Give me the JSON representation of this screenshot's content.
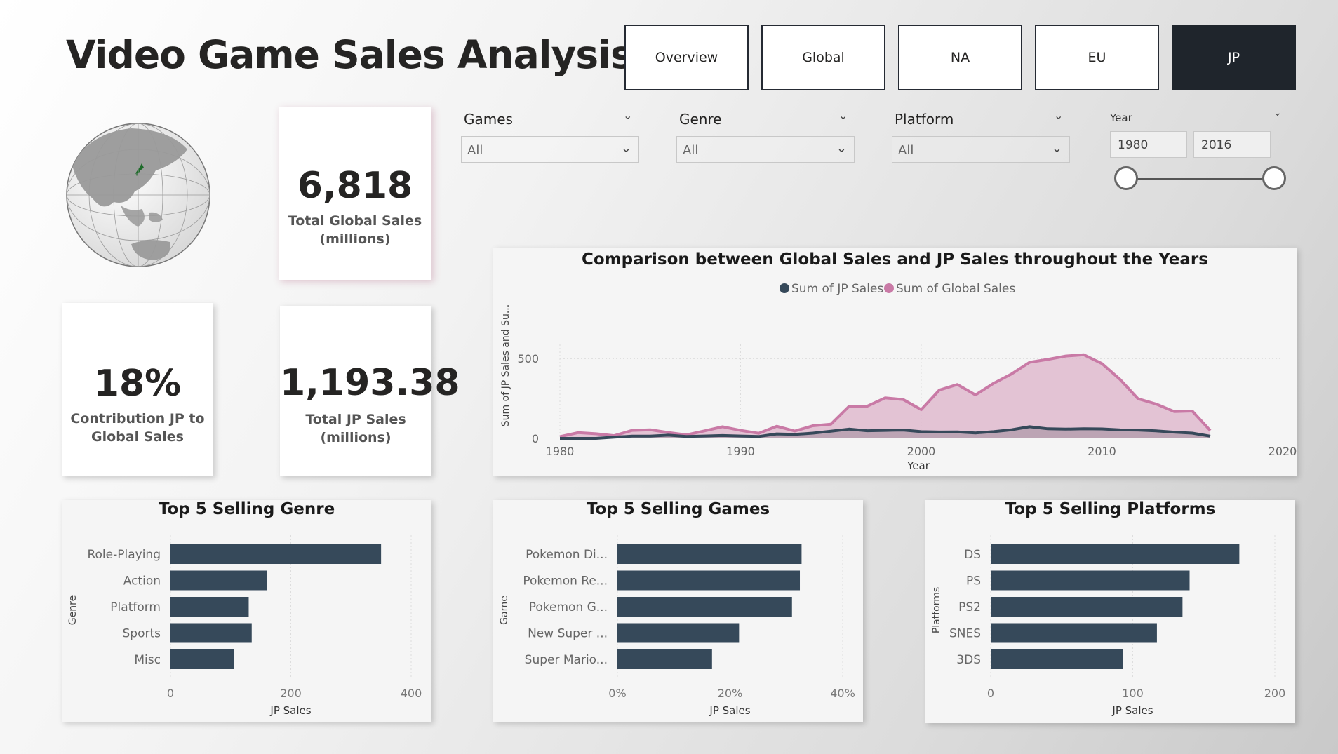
{
  "header": {
    "title": "Video Game Sales Analysis",
    "nav": [
      {
        "label": "Overview",
        "active": false
      },
      {
        "label": "Global",
        "active": false
      },
      {
        "label": "NA",
        "active": false
      },
      {
        "label": "EU",
        "active": false
      },
      {
        "label": "JP",
        "active": true
      }
    ]
  },
  "kpis": {
    "global_sales_value": "6,818",
    "global_sales_label_1": "Total Global Sales",
    "global_sales_label_2": "(millions)",
    "contribution_value": "18%",
    "contribution_label_1": "Contribution JP to",
    "contribution_label_2": "Global Sales",
    "jp_sales_value": "1,193.38",
    "jp_sales_label_1": "Total JP Sales",
    "jp_sales_label_2": "(millions)"
  },
  "slicers": {
    "games": {
      "label": "Games",
      "value": "All"
    },
    "genre": {
      "label": "Genre",
      "value": "All"
    },
    "platform": {
      "label": "Platform",
      "value": "All"
    },
    "year": {
      "label": "Year",
      "from": "1980",
      "to": "2016"
    }
  },
  "colors": {
    "dark_bar": "#36495a",
    "jp_line": "#36495a",
    "global_line": "#c97aa6",
    "global_fill": "#dcb1c8",
    "active_nav": "#1f252c"
  },
  "chart_data": [
    {
      "type": "area",
      "title": "Comparison between Global Sales and JP Sales throughout the Years",
      "xlabel": "Year",
      "ylabel": "Sum of JP Sales and Su...",
      "xlim": [
        1980,
        2020
      ],
      "ylim": [
        0,
        560
      ],
      "xticks": [
        "1980",
        "1990",
        "2000",
        "2010",
        "2020"
      ],
      "yticks": [
        "0",
        "500"
      ],
      "legend": "top-center",
      "x": [
        1980,
        1981,
        1982,
        1983,
        1984,
        1985,
        1986,
        1987,
        1988,
        1989,
        1990,
        1991,
        1992,
        1993,
        1994,
        1995,
        1996,
        1997,
        1998,
        1999,
        2000,
        2001,
        2002,
        2003,
        2004,
        2005,
        2006,
        2007,
        2008,
        2009,
        2010,
        2011,
        2012,
        2013,
        2014,
        2015,
        2016
      ],
      "series": [
        {
          "name": "Sum of JP Sales",
          "values": [
            0,
            0,
            0,
            8,
            14,
            14,
            20,
            12,
            15,
            18,
            15,
            12,
            28,
            25,
            33,
            45,
            58,
            48,
            50,
            52,
            42,
            40,
            41,
            34,
            42,
            54,
            73,
            60,
            58,
            60,
            59,
            53,
            52,
            47,
            39,
            33,
            14
          ]
        },
        {
          "name": "Sum of Global Sales",
          "values": [
            11,
            36,
            29,
            17,
            50,
            54,
            37,
            22,
            47,
            73,
            50,
            32,
            76,
            46,
            79,
            89,
            200,
            201,
            253,
            243,
            180,
            302,
            337,
            272,
            344,
            403,
            476,
            494,
            515,
            523,
            468,
            369,
            248,
            215,
            168,
            171,
            49
          ]
        }
      ]
    },
    {
      "type": "bar",
      "title": "Top 5 Selling Genre",
      "xlabel": "JP Sales",
      "ylabel": "Genre",
      "categories": [
        "Role-Playing",
        "Action",
        "Platform",
        "Sports",
        "Misc"
      ],
      "values": [
        350,
        160,
        130,
        135,
        105
      ],
      "xlim": [
        0,
        400
      ],
      "xticks": [
        "0",
        "200",
        "400"
      ]
    },
    {
      "type": "bar",
      "title": "Top 5 Selling Games",
      "xlabel": "JP Sales",
      "ylabel": "Game",
      "categories": [
        "Pokemon Di...",
        "Pokemon Re...",
        "Pokemon G...",
        "New Super ...",
        "Super Mario..."
      ],
      "values": [
        0.327,
        0.324,
        0.31,
        0.216,
        0.168
      ],
      "xlim": [
        0,
        0.4
      ],
      "xticks": [
        "0%",
        "20%",
        "40%"
      ]
    },
    {
      "type": "bar",
      "title": "Top 5 Selling Platforms",
      "xlabel": "JP Sales",
      "ylabel": "Platforms",
      "categories": [
        "DS",
        "PS",
        "PS2",
        "SNES",
        "3DS"
      ],
      "values": [
        175,
        140,
        135,
        117,
        93
      ],
      "xlim": [
        0,
        200
      ],
      "xticks": [
        "0",
        "100",
        "200"
      ]
    }
  ]
}
